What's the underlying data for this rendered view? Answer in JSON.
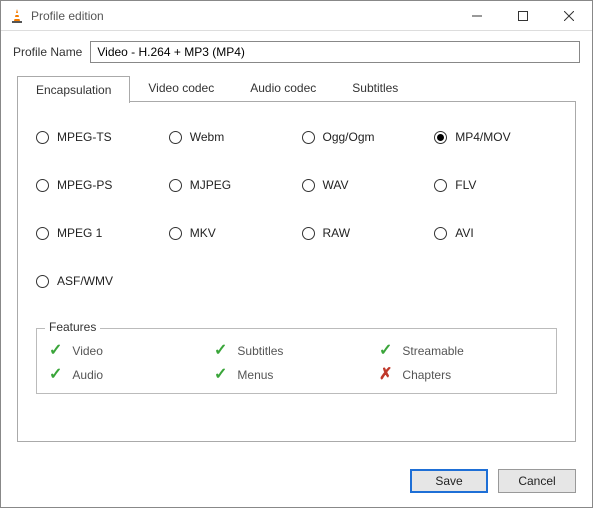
{
  "window": {
    "title": "Profile edition"
  },
  "profile": {
    "nameLabel": "Profile Name",
    "nameValue": "Video - H.264 + MP3 (MP4)"
  },
  "tabs": [
    "Encapsulation",
    "Video codec",
    "Audio codec",
    "Subtitles"
  ],
  "activeTab": "Encapsulation",
  "encapsulation": {
    "options": [
      {
        "label": "MPEG-TS",
        "checked": false
      },
      {
        "label": "Webm",
        "checked": false
      },
      {
        "label": "Ogg/Ogm",
        "checked": false
      },
      {
        "label": "MP4/MOV",
        "checked": true
      },
      {
        "label": "MPEG-PS",
        "checked": false
      },
      {
        "label": "MJPEG",
        "checked": false
      },
      {
        "label": "WAV",
        "checked": false
      },
      {
        "label": "FLV",
        "checked": false
      },
      {
        "label": "MPEG 1",
        "checked": false
      },
      {
        "label": "MKV",
        "checked": false
      },
      {
        "label": "RAW",
        "checked": false
      },
      {
        "label": "AVI",
        "checked": false
      },
      {
        "label": "ASF/WMV",
        "checked": false
      }
    ]
  },
  "features": {
    "legend": "Features",
    "items": [
      {
        "label": "Video",
        "ok": true
      },
      {
        "label": "Subtitles",
        "ok": true
      },
      {
        "label": "Streamable",
        "ok": true
      },
      {
        "label": "Audio",
        "ok": true
      },
      {
        "label": "Menus",
        "ok": true
      },
      {
        "label": "Chapters",
        "ok": false
      }
    ]
  },
  "buttons": {
    "save": "Save",
    "cancel": "Cancel"
  }
}
